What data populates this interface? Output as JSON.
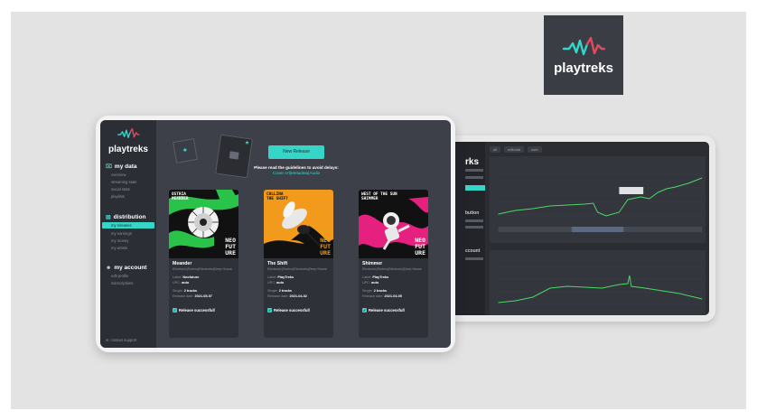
{
  "brand": {
    "name": "playtreks",
    "accent": "#35d6c8",
    "wave_colors": [
      "#35d6c8",
      "#e8485e"
    ]
  },
  "sidebar": {
    "sections": [
      {
        "title": "my data",
        "icon": "chart-icon",
        "items": [
          "overview",
          "streaming stats",
          "social stats",
          "playlists"
        ]
      },
      {
        "title": "distribution",
        "icon": "stack-icon",
        "items": [
          "my releases",
          "my earnings",
          "my money",
          "my artists"
        ],
        "active": "my releases"
      },
      {
        "title": "my account",
        "icon": "person-icon",
        "items": [
          "edit profile",
          "subscriptions"
        ]
      }
    ],
    "contact": "contact support"
  },
  "main": {
    "new_release_label": "New Release",
    "guidelines_text": "Please read the guidelines to avoid delays:",
    "guidelines_links": [
      "Cover Art",
      "Metadata",
      "Audio"
    ],
    "releases": [
      {
        "title": "Meander",
        "genres": "Electronic|Techno|Electronic|Deep House",
        "label_name": "Label:",
        "label_value": "Neofuture",
        "upc_name": "UPC:",
        "upc_value": "auto",
        "format_name": "Single:",
        "format_value": "2 tracks",
        "date_name": "Release date:",
        "date_value": "2021-05-07",
        "status": "Release successfull",
        "art_top": "OSTRIA\nMEANDER",
        "art_bottom": "NEO\nFUT\nURE"
      },
      {
        "title": "The Shift",
        "genres": "Electronic|Techno|Electronic|Deep House",
        "label_name": "Label:",
        "label_value": "PlayTreks",
        "upc_name": "UPC:",
        "upc_value": "auto",
        "format_name": "Single:",
        "format_value": "2 tracks",
        "date_name": "Release date:",
        "date_value": "2021-04-02",
        "status": "Release successfull",
        "art_top": "COLLINA\nTHE SHIFT",
        "art_bottom": "NEO\nFUT\nURE"
      },
      {
        "title": "Shimmer",
        "genres": "Electronic|Techno|Electronic|Deep House",
        "label_name": "Label:",
        "label_value": "PlayTreks",
        "upc_name": "UPC:",
        "upc_value": "auto",
        "format_name": "Single:",
        "format_value": "2 tracks",
        "date_name": "Release date:",
        "date_value": "2021-03-05",
        "status": "Release successfull",
        "art_top": "WEST OF THE SUN\nSHIMMER",
        "art_bottom": "NEO\nFUT\nURE"
      }
    ]
  },
  "stats_tablet": {
    "sidebar_title": "rks",
    "section_labels": [
      "bution",
      "ccount"
    ],
    "filter_chips": [
      "all",
      "editorial",
      "user"
    ],
    "chart_colors": {
      "line": "#4cd964",
      "background": "#33363d"
    }
  }
}
